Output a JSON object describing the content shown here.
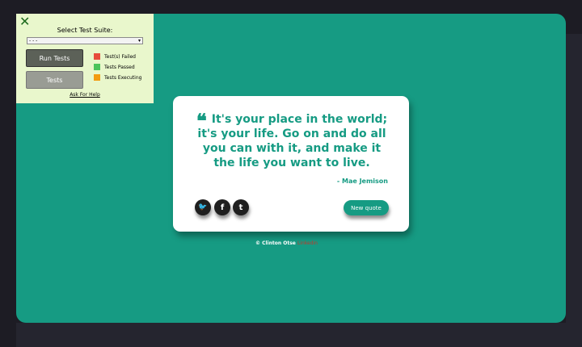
{
  "quote": {
    "mark": "❝",
    "text": "It's your place in the world; it's your life. Go on and do all you can with it, and make it the life you want to live.",
    "author": "- Mae Jemison"
  },
  "social": {
    "twitter": "🐦",
    "facebook": "f",
    "tumblr": "t"
  },
  "new_quote_label": "New quote",
  "footer": {
    "credit": "© Clinton Otse",
    "link": "Linkedin"
  },
  "test_panel": {
    "close": "✕",
    "title": "Select Test Suite:",
    "select_value": "- - -",
    "run_label": "Run Tests",
    "tests_label": "Tests",
    "legend": [
      {
        "label": "Test(s) Failed",
        "color": "#e74c3c"
      },
      {
        "label": "Tests Passed",
        "color": "#4cc45b"
      },
      {
        "label": "Tests Executing",
        "color": "#f39c12"
      }
    ],
    "help": "Ask For Help"
  },
  "colors": {
    "accent": "#169b83",
    "background": "#1d1c24"
  }
}
